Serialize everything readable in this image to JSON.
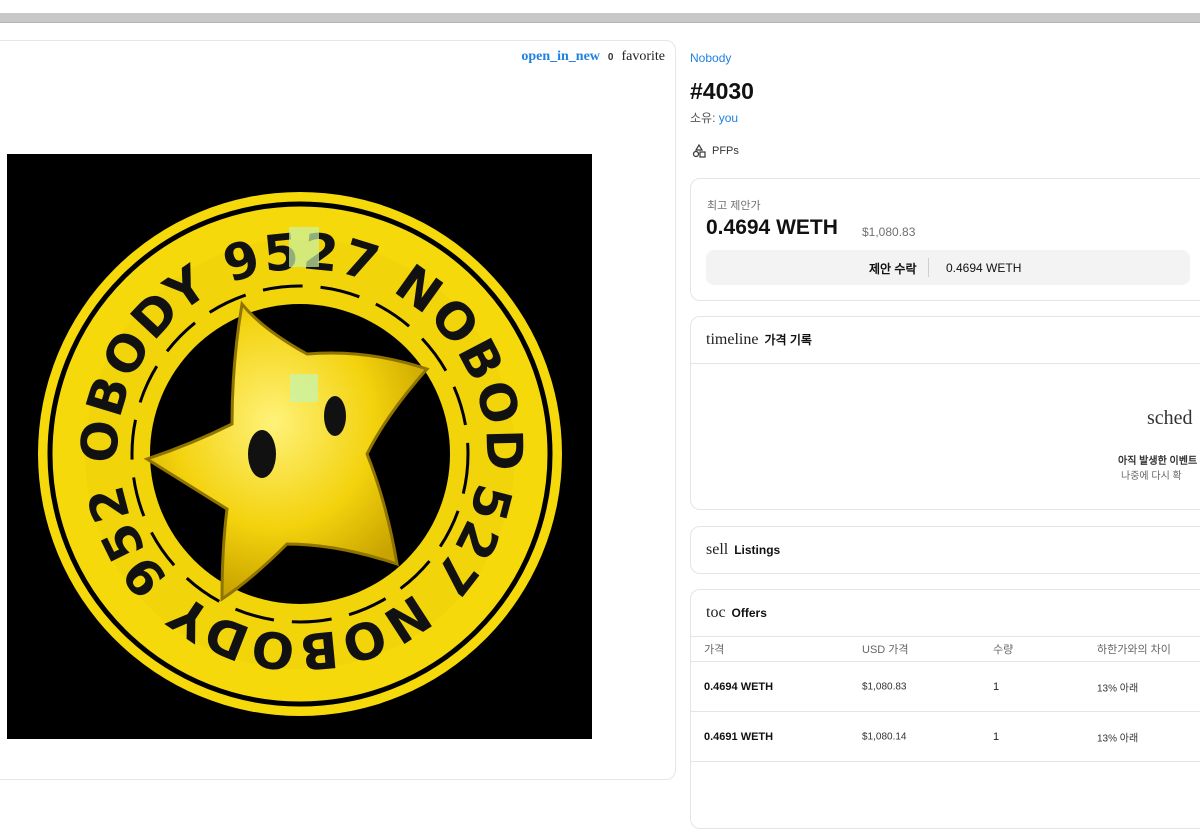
{
  "toolbar": {
    "open_icon_text": "open_in_new",
    "favorite_count": "0",
    "favorite_icon_text": "favorite"
  },
  "artwork": {
    "ring_text_top": "NOBODY 9527 NOBODY",
    "ring_text_bottom": "9527 NOBODY 9527"
  },
  "item": {
    "collection": "Nobody",
    "title": "#4030",
    "owner_label": "소유: ",
    "owner_value": "you",
    "category": "PFPs"
  },
  "offer_summary": {
    "label": "최고 제안가",
    "price": "0.4694 WETH",
    "usd": "$1,080.83",
    "accept_label": "제안 수락",
    "accept_price": "0.4694 WETH"
  },
  "price_history": {
    "icon_text": "timeline",
    "title": "가격 기록",
    "empty_icon_text": "sched",
    "empty_line1": "아직 발생한 이벤트",
    "empty_line2": "나중에 다시 확"
  },
  "listings": {
    "icon_text": "sell",
    "title": "Listings"
  },
  "offers": {
    "icon_text": "toc",
    "title": "Offers",
    "headers": [
      "가격",
      "USD 가격",
      "수량",
      "하한가와의 차이"
    ],
    "rows": [
      [
        "0.4694 WETH",
        "$1,080.83",
        "1",
        "13% 아래"
      ],
      [
        "0.4691 WETH",
        "$1,080.14",
        "1",
        "13% 아래"
      ]
    ]
  },
  "colors": {
    "link": "#2081e2",
    "art_background": "#000000",
    "art_yellow": "#f5d90a"
  }
}
